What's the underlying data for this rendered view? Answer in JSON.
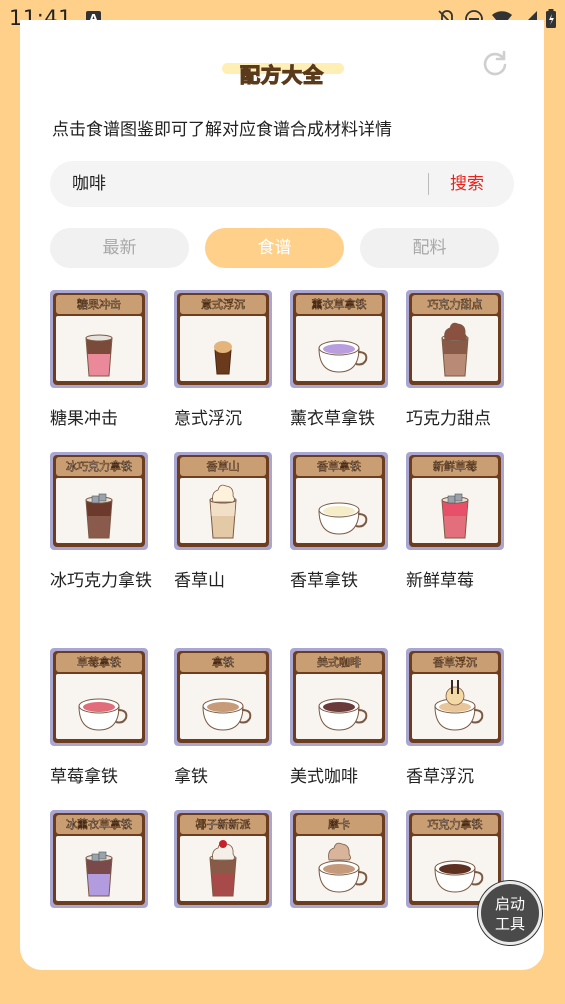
{
  "status": {
    "time": "11:41",
    "notice_letter": "A"
  },
  "header": {
    "title": "配方大全"
  },
  "hint": "点击食谱图鉴即可了解对应食谱合成材料详情",
  "search": {
    "value": "咖啡",
    "button": "搜索"
  },
  "tabs": [
    {
      "label": "最新",
      "active": false
    },
    {
      "label": "食谱",
      "active": true
    },
    {
      "label": "配料",
      "active": false
    }
  ],
  "items": [
    {
      "name": "糖果冲击",
      "tag": "糖果冲击",
      "drink": "glass-choc-pink"
    },
    {
      "name": "意式浮沉",
      "tag": "意式浮沉",
      "drink": "small-glass"
    },
    {
      "name": "薰衣草拿铁",
      "tag": "薰衣草拿铁",
      "drink": "cup-lavender"
    },
    {
      "name": "巧克力甜点",
      "tag": "巧克力甜点",
      "drink": "glass-cream-choc"
    },
    {
      "name": "冰巧克力拿铁",
      "tag": "冰巧克力拿铁",
      "drink": "glass-ice-choc"
    },
    {
      "name": "香草山",
      "tag": "香草山",
      "drink": "glass-vanilla"
    },
    {
      "name": "香草拿铁",
      "tag": "香草拿铁",
      "drink": "cup-vanilla"
    },
    {
      "name": "新鲜草莓",
      "tag": "新鲜草莓",
      "drink": "glass-strawberry"
    },
    {
      "name": "草莓拿铁",
      "tag": "草莓拿铁",
      "drink": "cup-strawberry"
    },
    {
      "name": "拿铁",
      "tag": "拿铁",
      "drink": "cup-latte"
    },
    {
      "name": "美式咖啡",
      "tag": "美式咖啡",
      "drink": "cup-americano"
    },
    {
      "name": "香草浮沉",
      "tag": "香草浮沉",
      "drink": "cup-float"
    },
    {
      "name": "",
      "tag": "冰薰衣草拿铁",
      "drink": "glass-ice-lavender"
    },
    {
      "name": "",
      "tag": "椰子新新派",
      "drink": "glass-sundae"
    },
    {
      "name": "",
      "tag": "摩卡",
      "drink": "cup-mocha"
    },
    {
      "name": "",
      "tag": "巧克力拿铁",
      "drink": "cup-choc"
    }
  ],
  "fab": {
    "line1": "启动",
    "line2": "工具"
  }
}
